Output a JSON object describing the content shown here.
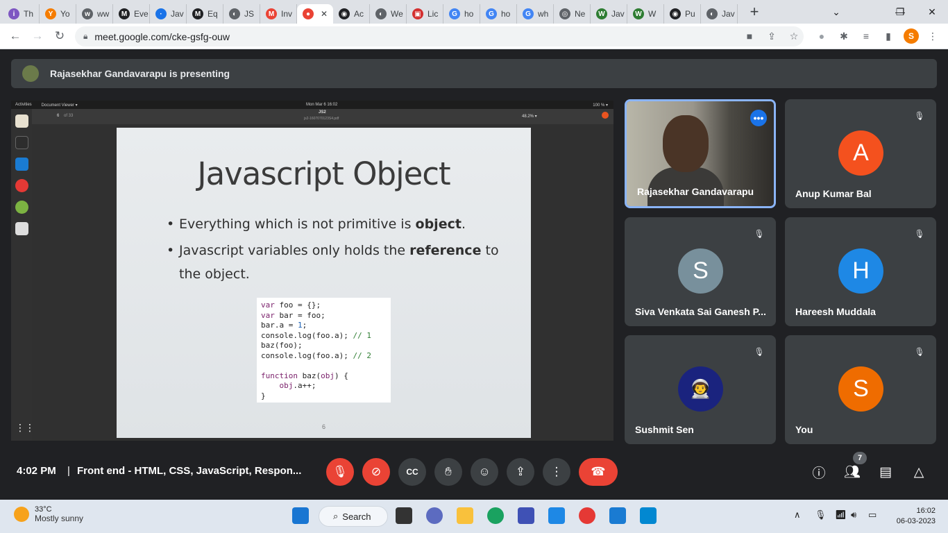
{
  "browser": {
    "tabs": [
      {
        "label": "Th",
        "color": "#7e57c2",
        "glyph": "i"
      },
      {
        "label": "Yo",
        "color": "#f57c00",
        "glyph": "Y"
      },
      {
        "label": "ww",
        "color": "#5f6368",
        "glyph": "w"
      },
      {
        "label": "Eve",
        "color": "#202124",
        "glyph": "M"
      },
      {
        "label": "Jav",
        "color": "#1a73e8",
        "glyph": "·"
      },
      {
        "label": "Eq",
        "color": "#202124",
        "glyph": "M"
      },
      {
        "label": "JS",
        "color": "#5f6368",
        "glyph": "◐"
      },
      {
        "label": "Inv",
        "color": "#ea4335",
        "glyph": "M"
      },
      {
        "label": "",
        "color": "#ea4335",
        "glyph": "●"
      },
      {
        "label": "Ac",
        "color": "#202124",
        "glyph": "◉"
      },
      {
        "label": "We",
        "color": "#5f6368",
        "glyph": "◐"
      },
      {
        "label": "Lic",
        "color": "#d32f2f",
        "glyph": "▣"
      },
      {
        "label": "ho",
        "color": "#4285f4",
        "glyph": "G"
      },
      {
        "label": "ho",
        "color": "#4285f4",
        "glyph": "G"
      },
      {
        "label": "wh",
        "color": "#4285f4",
        "glyph": "G"
      },
      {
        "label": "Ne",
        "color": "#5f6368",
        "glyph": "◎"
      },
      {
        "label": "Jav",
        "color": "#2e7d32",
        "glyph": "W"
      },
      {
        "label": "W",
        "color": "#2e7d32",
        "glyph": "W"
      },
      {
        "label": "Pu",
        "color": "#202124",
        "glyph": "◉"
      },
      {
        "label": "Jav",
        "color": "#5f6368",
        "glyph": "◐"
      }
    ],
    "new_tab": "+",
    "url": "meet.google.com/cke-gsfg-ouw",
    "profile_initial": "S"
  },
  "meet": {
    "presenting_text": "Rajasekhar Gandavarapu is presenting",
    "shared_screen": {
      "topbar_left": "Activities",
      "topbar_app": "Document Viewer ▾",
      "topbar_clock": "Mon Mar 6  16:02",
      "topbar_right": "100 % ▾",
      "doc_title": "JS2",
      "doc_file": "js2-1607070123S4.pdf",
      "page_current": "6",
      "page_of": "of 33",
      "zoom": "48.2% ▾",
      "slide": {
        "title": "Javascript Object",
        "bullet1_pre": "Everything which is not primitive is ",
        "bullet1_bold": "object",
        "bullet1_post": ".",
        "bullet2_pre": "Javascript variables only holds the ",
        "bullet2_bold": "reference",
        "bullet2_post": " to",
        "bullet2_line2": "the object.",
        "page_number": "6"
      }
    },
    "participants": [
      {
        "name": "Rajasekhar Gandavarapu",
        "initial": "",
        "color": ""
      },
      {
        "name": "Anup Kumar Bal",
        "initial": "A",
        "color": "#f4511e"
      },
      {
        "name": "Siva Venkata Sai Ganesh P...",
        "initial": "S",
        "color": "#78909c"
      },
      {
        "name": "Hareesh Muddala",
        "initial": "H",
        "color": "#1e88e5"
      },
      {
        "name": "Sushmit Sen",
        "initial": "",
        "color": "#1a237e"
      },
      {
        "name": "You",
        "initial": "S",
        "color": "#ef6c00"
      }
    ],
    "bottom": {
      "time": "4:02 PM",
      "separator": "|",
      "meeting_name": "Front end - HTML, CSS, JavaScript, Respon...",
      "participant_count": "7"
    }
  },
  "taskbar": {
    "temperature": "33°C",
    "weather": "Mostly sunny",
    "search_label": "Search",
    "time": "16:02",
    "date": "06-03-2023"
  }
}
